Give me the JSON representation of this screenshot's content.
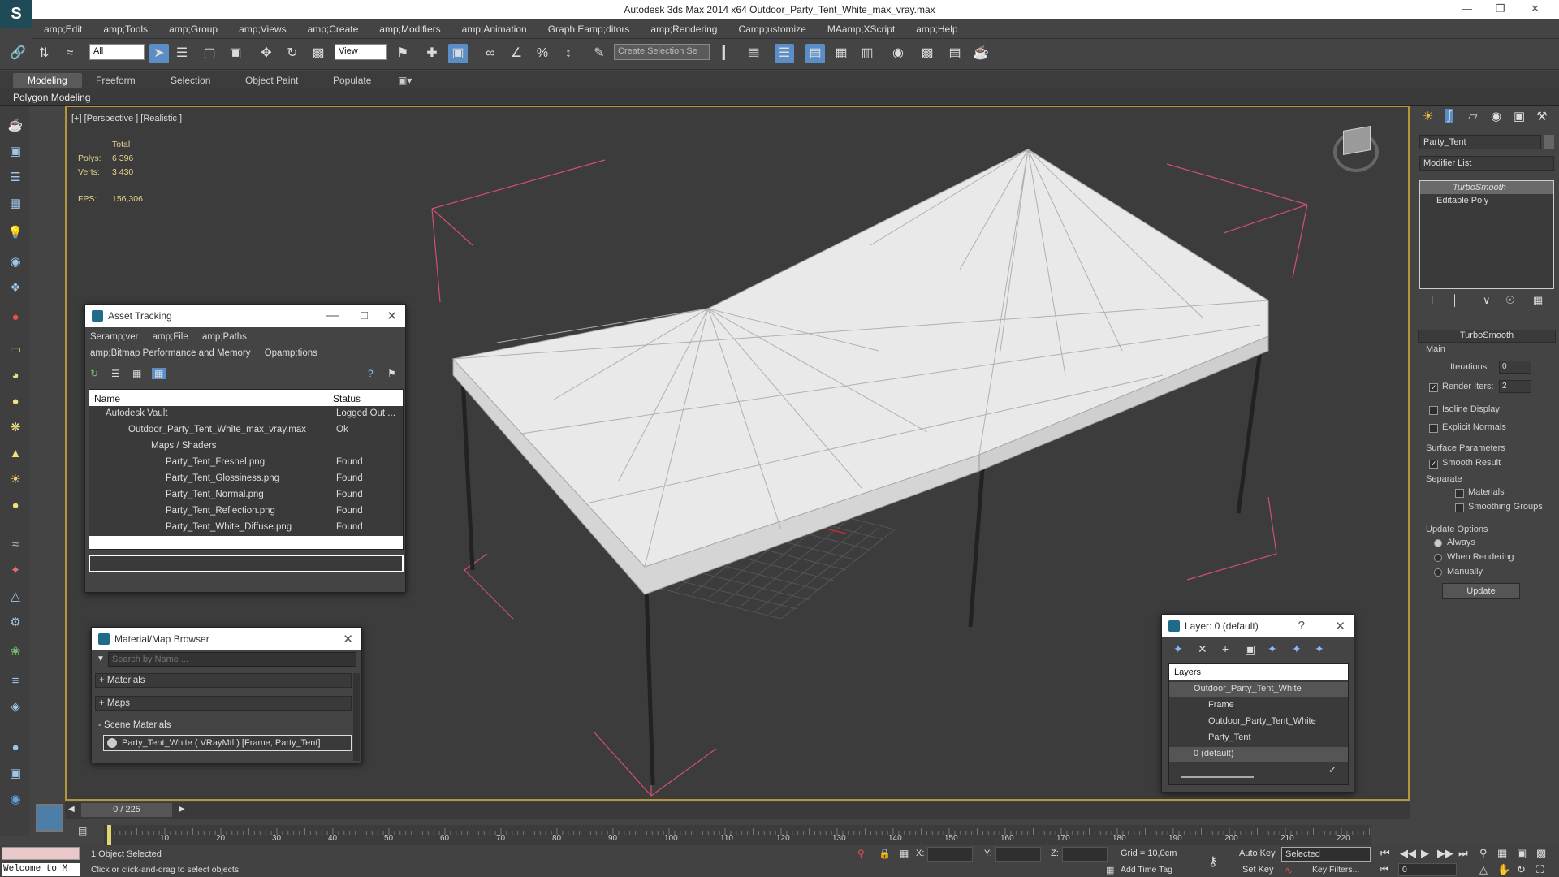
{
  "window": {
    "title": "Autodesk 3ds Max  2014 x64    Outdoor_Party_Tent_White_max_vray.max"
  },
  "menu": [
    "amp;Edit",
    "amp;Tools",
    "amp;Group",
    "amp;Views",
    "amp;Create",
    "amp;Modifiers",
    "amp;Animation",
    "Graph Eamp;ditors",
    "amp;Rendering",
    "Camp;ustomize",
    "MAamp;XScript",
    "amp;Help"
  ],
  "toolbar": {
    "filter": "All",
    "refcoord": "View",
    "selection_set": "Create Selection Se"
  },
  "ribbon": {
    "tabs": [
      "Modeling",
      "Freeform",
      "Selection",
      "Object Paint",
      "Populate"
    ],
    "panel": "Polygon Modeling"
  },
  "viewport": {
    "label": "[+] [Perspective ] [Realistic ]",
    "stats_header": "Total",
    "polys_label": "Polys:",
    "polys": "6 396",
    "verts_label": "Verts:",
    "verts": "3 430",
    "fps_label": "FPS:",
    "fps": "156,306"
  },
  "asset_tracking": {
    "title": "Asset Tracking",
    "menu": [
      "Seramp;ver",
      "amp;File",
      "amp;Paths",
      "amp;Bitmap Performance and Memory",
      "Opamp;tions"
    ],
    "col_name": "Name",
    "col_status": "Status",
    "rows": [
      {
        "name": "Autodesk Vault",
        "status": "Logged Out ..."
      },
      {
        "name": "Outdoor_Party_Tent_White_max_vray.max",
        "status": "Ok"
      },
      {
        "name": "Maps / Shaders",
        "status": ""
      },
      {
        "name": "Party_Tent_Fresnel.png",
        "status": "Found"
      },
      {
        "name": "Party_Tent_Glossiness.png",
        "status": "Found"
      },
      {
        "name": "Party_Tent_Normal.png",
        "status": "Found"
      },
      {
        "name": "Party_Tent_Reflection.png",
        "status": "Found"
      },
      {
        "name": "Party_Tent_White_Diffuse.png",
        "status": "Found"
      }
    ]
  },
  "material_browser": {
    "title": "Material/Map Browser",
    "search_placeholder": "Search by Name ...",
    "materials": "+ Materials",
    "maps": "+ Maps",
    "scene_materials": "- Scene Materials",
    "scene_item": "Party_Tent_White  ( VRayMtl ) [Frame, Party_Tent]"
  },
  "layer_dialog": {
    "title": "Layer: 0 (default)",
    "header": "Layers",
    "items": [
      "Outdoor_Party_Tent_White",
      "Frame",
      "Outdoor_Party_Tent_White",
      "Party_Tent",
      "0 (default)"
    ]
  },
  "command_panel": {
    "object_name": "Party_Tent",
    "modifier_list": "Modifier List",
    "stack": [
      "TurboSmooth",
      "Editable Poly"
    ],
    "rollout": "TurboSmooth",
    "main": "Main",
    "iterations_label": "Iterations:",
    "iterations": "0",
    "render_iters_label": "Render Iters:",
    "render_iters": "2",
    "isoline": "Isoline Display",
    "explicit": "Explicit Normals",
    "surface": "Surface Parameters",
    "smooth_result": "Smooth Result",
    "separate": "Separate",
    "materials": "Materials",
    "smoothing": "Smoothing Groups",
    "update_options": "Update Options",
    "always": "Always",
    "when_rendering": "When Rendering",
    "manually": "Manually",
    "update_btn": "Update"
  },
  "timeline": {
    "frame": "0 / 225",
    "ticks": [
      "10",
      "20",
      "30",
      "40",
      "50",
      "60",
      "70",
      "80",
      "90",
      "100",
      "110",
      "120",
      "130",
      "140",
      "150",
      "160",
      "170",
      "180",
      "190",
      "200",
      "210",
      "220"
    ]
  },
  "status": {
    "welcome": "Welcome to M",
    "selected": "1 Object Selected",
    "prompt": "Click or click-and-drag to select objects",
    "x_label": "X:",
    "y_label": "Y:",
    "z_label": "Z:",
    "grid": "Grid = 10,0cm",
    "add_time_tag": "Add Time Tag",
    "auto_key": "Auto Key",
    "set_key": "Set Key",
    "key_mode": "Selected",
    "key_filters": "Key Filters...",
    "frame_field": "0"
  },
  "colors": {
    "accent": "#5b8ec7",
    "viewport_border": "#b7953a",
    "stats": "#e8d58a",
    "bounding": "#d05070"
  }
}
